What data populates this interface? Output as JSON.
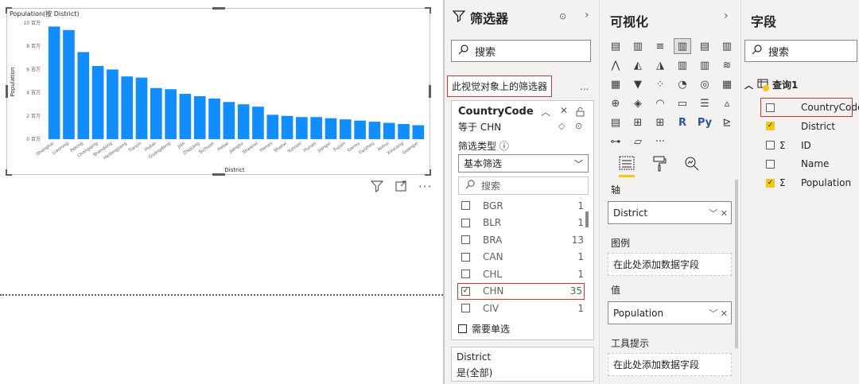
{
  "chart_data": {
    "type": "bar",
    "title": "Population(按 District)",
    "xlabel": "District",
    "ylabel": "Population",
    "categories": [
      "Shanghai",
      "Liaoning",
      "Peking",
      "Chongqing",
      "Shandong",
      "Heilongjiang",
      "Tianjin",
      "Hubei",
      "Guangdong",
      "Jilin",
      "Zhejiang",
      "Sichuan",
      "Hebei",
      "Jiangsu",
      "Shaanxi",
      "Henan",
      "Shanxi",
      "Yunnan",
      "Hunan",
      "Jiangxi",
      "Fujian",
      "Gansu",
      "Guizhou",
      "Anhui",
      "Xinxiang",
      "Guangxi"
    ],
    "values": [
      9.7,
      9.4,
      7.5,
      6.3,
      6.0,
      5.4,
      5.3,
      4.4,
      4.3,
      3.9,
      3.7,
      3.5,
      3.2,
      3.0,
      2.8,
      2.1,
      2.0,
      1.9,
      1.9,
      1.8,
      1.7,
      1.6,
      1.5,
      1.4,
      1.3,
      1.2
    ],
    "ylim": [
      0,
      10
    ],
    "yticks": [
      0,
      2,
      4,
      6,
      8,
      10
    ],
    "ytick_labels": [
      "0 百万",
      "2 百万",
      "4 百万",
      "6 百万",
      "8 百万",
      "10 百万"
    ],
    "bar_color": "#118dff",
    "grid": false,
    "legend": "none"
  },
  "filters": {
    "title": "筛选器",
    "search_placeholder": "搜索",
    "section_label": "此视觉对象上的筛选器",
    "more": "...",
    "card": {
      "field": "CountryCode",
      "condition": "等于 CHN",
      "type_label": "筛选类型 ⓘ",
      "type_value": "基本筛选",
      "search_placeholder": "搜索",
      "items": [
        {
          "name": "BGR",
          "count": "1",
          "checked": false
        },
        {
          "name": "BLR",
          "count": "1",
          "checked": false
        },
        {
          "name": "BRA",
          "count": "13",
          "checked": false
        },
        {
          "name": "CAN",
          "count": "1",
          "checked": false
        },
        {
          "name": "CHL",
          "count": "1",
          "checked": false
        },
        {
          "name": "CHN",
          "count": "35",
          "checked": true
        },
        {
          "name": "CIV",
          "count": "1",
          "checked": false
        }
      ],
      "single_select": "需要单选"
    },
    "card2": {
      "field": "District",
      "condition": "是(全部)"
    }
  },
  "viz": {
    "title": "可视化",
    "wells": {
      "axis_label": "轴",
      "axis_value": "District",
      "legend_label": "图例",
      "legend_placeholder": "在此处添加数据字段",
      "values_label": "值",
      "values_value": "Population",
      "tooltip_label": "工具提示",
      "tooltip_placeholder": "在此处添加数据字段"
    },
    "icon_text": {
      "r": "R",
      "py": "Py",
      "more": "···"
    }
  },
  "fields": {
    "title": "字段",
    "search_placeholder": "搜索",
    "table": "查询1",
    "items": [
      {
        "name": "CountryCode",
        "checked": false,
        "sigma": false
      },
      {
        "name": "District",
        "checked": true,
        "sigma": false
      },
      {
        "name": "ID",
        "checked": false,
        "sigma": true
      },
      {
        "name": "Name",
        "checked": false,
        "sigma": false
      },
      {
        "name": "Population",
        "checked": true,
        "sigma": true
      }
    ]
  }
}
